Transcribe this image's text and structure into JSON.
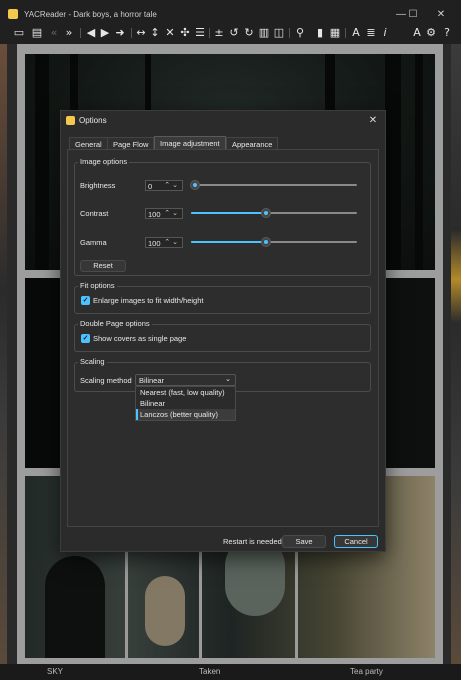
{
  "window": {
    "title": "YACReader - Dark boys, a horror tale",
    "controls": {
      "minimize": "—",
      "maximize": "☐",
      "close": "✕"
    }
  },
  "toolbar": {
    "icons": [
      "open-icon",
      "open-folder-icon",
      "back-icon",
      "forward-icon",
      "prev-page-icon",
      "next-page-icon",
      "goto-icon",
      "fit-width-icon",
      "fit-height-icon",
      "fit-page-icon",
      "reset-zoom-icon",
      "zoom-icon",
      "rotate-left-icon",
      "rotate-right-icon",
      "double-page-icon",
      "manga-icon",
      "magnifier-icon",
      "bookmark-icon",
      "show-bookmarks-icon",
      "translator-icon",
      "info-icon",
      "settings-icon",
      "help-icon"
    ]
  },
  "bottombar": {
    "items": [
      "SKY",
      "Taken",
      "Tea party"
    ]
  },
  "dialog": {
    "title": "Options",
    "close": "✕",
    "tabs": [
      {
        "label": "General"
      },
      {
        "label": "Page Flow"
      },
      {
        "label": "Image adjustment",
        "active": true
      },
      {
        "label": "Appearance"
      }
    ],
    "image_options": {
      "title": "Image options",
      "brightness": {
        "label": "Brightness",
        "value": "0",
        "level": 0.0
      },
      "contrast": {
        "label": "Contrast",
        "value": "100",
        "level": 0.45
      },
      "gamma": {
        "label": "Gamma",
        "value": "100",
        "level": 0.45
      },
      "reset_label": "Reset"
    },
    "fit_options": {
      "title": "Fit options",
      "enlarge_label": "Enlarge images to fit width/height",
      "enlarge_checked": true
    },
    "double_page_options": {
      "title": "Double Page options",
      "covers_label": "Show covers as single page",
      "covers_checked": true
    },
    "scaling": {
      "title": "Scaling",
      "method_label": "Scaling method",
      "selected": "Bilinear",
      "options": [
        "Nearest (fast, low quality)",
        "Bilinear",
        "Lanczos (better quality)"
      ],
      "highlighted": "Lanczos (better quality)"
    },
    "footer": {
      "restart_note": "Restart is needed",
      "save_label": "Save",
      "cancel_label": "Cancel"
    }
  },
  "colors": {
    "accent": "#4cc2ff",
    "dialog_bg": "#2b2b2b"
  }
}
